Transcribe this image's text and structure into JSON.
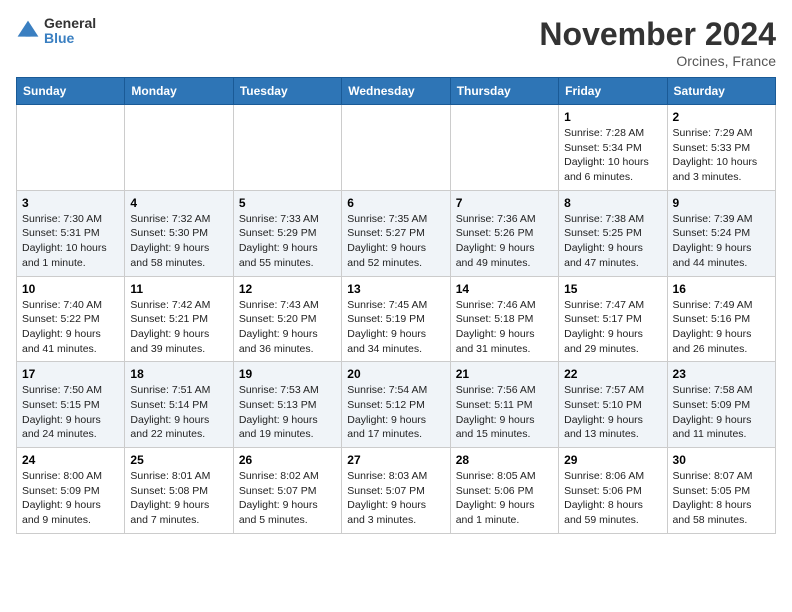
{
  "header": {
    "logo_line1": "General",
    "logo_line2": "Blue",
    "month_title": "November 2024",
    "location": "Orcines, France"
  },
  "days_of_week": [
    "Sunday",
    "Monday",
    "Tuesday",
    "Wednesday",
    "Thursday",
    "Friday",
    "Saturday"
  ],
  "weeks": [
    [
      {
        "day": "",
        "content": ""
      },
      {
        "day": "",
        "content": ""
      },
      {
        "day": "",
        "content": ""
      },
      {
        "day": "",
        "content": ""
      },
      {
        "day": "",
        "content": ""
      },
      {
        "day": "1",
        "content": "Sunrise: 7:28 AM\nSunset: 5:34 PM\nDaylight: 10 hours and 6 minutes."
      },
      {
        "day": "2",
        "content": "Sunrise: 7:29 AM\nSunset: 5:33 PM\nDaylight: 10 hours and 3 minutes."
      }
    ],
    [
      {
        "day": "3",
        "content": "Sunrise: 7:30 AM\nSunset: 5:31 PM\nDaylight: 10 hours and 1 minute."
      },
      {
        "day": "4",
        "content": "Sunrise: 7:32 AM\nSunset: 5:30 PM\nDaylight: 9 hours and 58 minutes."
      },
      {
        "day": "5",
        "content": "Sunrise: 7:33 AM\nSunset: 5:29 PM\nDaylight: 9 hours and 55 minutes."
      },
      {
        "day": "6",
        "content": "Sunrise: 7:35 AM\nSunset: 5:27 PM\nDaylight: 9 hours and 52 minutes."
      },
      {
        "day": "7",
        "content": "Sunrise: 7:36 AM\nSunset: 5:26 PM\nDaylight: 9 hours and 49 minutes."
      },
      {
        "day": "8",
        "content": "Sunrise: 7:38 AM\nSunset: 5:25 PM\nDaylight: 9 hours and 47 minutes."
      },
      {
        "day": "9",
        "content": "Sunrise: 7:39 AM\nSunset: 5:24 PM\nDaylight: 9 hours and 44 minutes."
      }
    ],
    [
      {
        "day": "10",
        "content": "Sunrise: 7:40 AM\nSunset: 5:22 PM\nDaylight: 9 hours and 41 minutes."
      },
      {
        "day": "11",
        "content": "Sunrise: 7:42 AM\nSunset: 5:21 PM\nDaylight: 9 hours and 39 minutes."
      },
      {
        "day": "12",
        "content": "Sunrise: 7:43 AM\nSunset: 5:20 PM\nDaylight: 9 hours and 36 minutes."
      },
      {
        "day": "13",
        "content": "Sunrise: 7:45 AM\nSunset: 5:19 PM\nDaylight: 9 hours and 34 minutes."
      },
      {
        "day": "14",
        "content": "Sunrise: 7:46 AM\nSunset: 5:18 PM\nDaylight: 9 hours and 31 minutes."
      },
      {
        "day": "15",
        "content": "Sunrise: 7:47 AM\nSunset: 5:17 PM\nDaylight: 9 hours and 29 minutes."
      },
      {
        "day": "16",
        "content": "Sunrise: 7:49 AM\nSunset: 5:16 PM\nDaylight: 9 hours and 26 minutes."
      }
    ],
    [
      {
        "day": "17",
        "content": "Sunrise: 7:50 AM\nSunset: 5:15 PM\nDaylight: 9 hours and 24 minutes."
      },
      {
        "day": "18",
        "content": "Sunrise: 7:51 AM\nSunset: 5:14 PM\nDaylight: 9 hours and 22 minutes."
      },
      {
        "day": "19",
        "content": "Sunrise: 7:53 AM\nSunset: 5:13 PM\nDaylight: 9 hours and 19 minutes."
      },
      {
        "day": "20",
        "content": "Sunrise: 7:54 AM\nSunset: 5:12 PM\nDaylight: 9 hours and 17 minutes."
      },
      {
        "day": "21",
        "content": "Sunrise: 7:56 AM\nSunset: 5:11 PM\nDaylight: 9 hours and 15 minutes."
      },
      {
        "day": "22",
        "content": "Sunrise: 7:57 AM\nSunset: 5:10 PM\nDaylight: 9 hours and 13 minutes."
      },
      {
        "day": "23",
        "content": "Sunrise: 7:58 AM\nSunset: 5:09 PM\nDaylight: 9 hours and 11 minutes."
      }
    ],
    [
      {
        "day": "24",
        "content": "Sunrise: 8:00 AM\nSunset: 5:09 PM\nDaylight: 9 hours and 9 minutes."
      },
      {
        "day": "25",
        "content": "Sunrise: 8:01 AM\nSunset: 5:08 PM\nDaylight: 9 hours and 7 minutes."
      },
      {
        "day": "26",
        "content": "Sunrise: 8:02 AM\nSunset: 5:07 PM\nDaylight: 9 hours and 5 minutes."
      },
      {
        "day": "27",
        "content": "Sunrise: 8:03 AM\nSunset: 5:07 PM\nDaylight: 9 hours and 3 minutes."
      },
      {
        "day": "28",
        "content": "Sunrise: 8:05 AM\nSunset: 5:06 PM\nDaylight: 9 hours and 1 minute."
      },
      {
        "day": "29",
        "content": "Sunrise: 8:06 AM\nSunset: 5:06 PM\nDaylight: 8 hours and 59 minutes."
      },
      {
        "day": "30",
        "content": "Sunrise: 8:07 AM\nSunset: 5:05 PM\nDaylight: 8 hours and 58 minutes."
      }
    ]
  ]
}
